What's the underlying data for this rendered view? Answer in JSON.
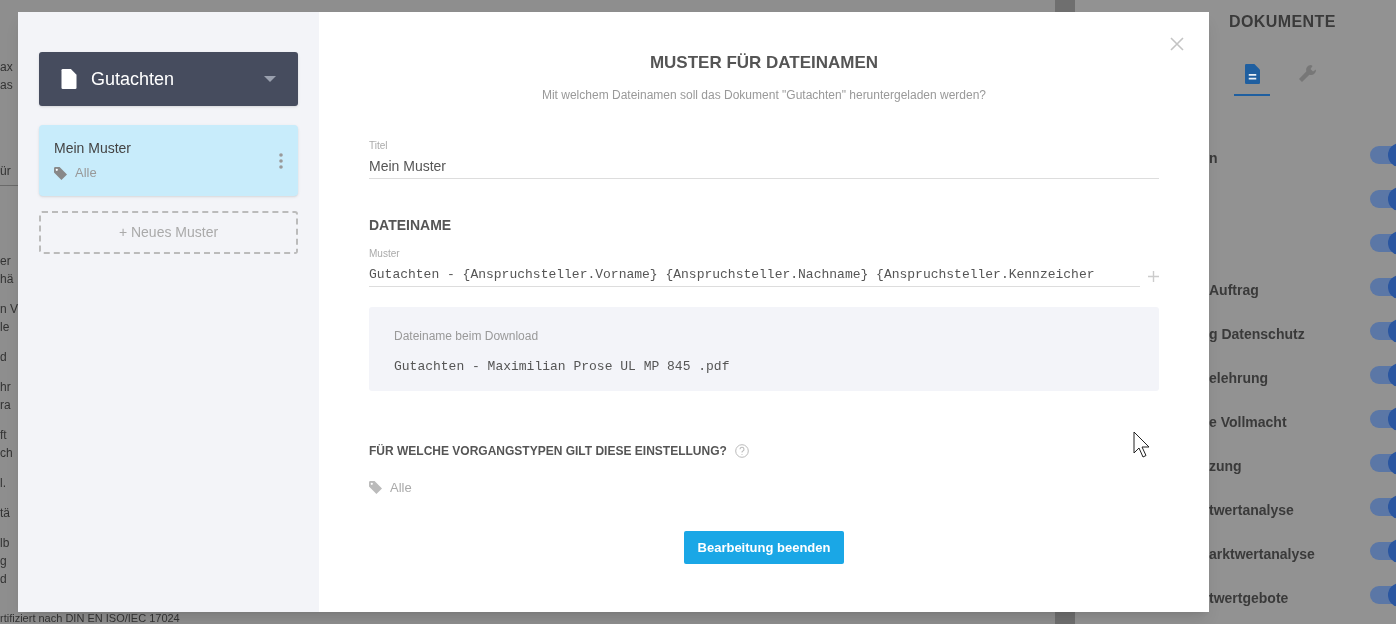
{
  "background": {
    "left_fragments": [
      "ax",
      "as",
      "ür",
      "er",
      "hä",
      "n V",
      "le",
      "d",
      "hr",
      "ra",
      "ft",
      "ch",
      "l.",
      "tä",
      "lb",
      "g",
      "d"
    ],
    "footer_fragment": "rtifiziert nach DIN EN ISO/IEC 17024",
    "panel": {
      "title": "DOKUMENTE",
      "tabs": [
        {
          "kind": "document",
          "selected": true
        },
        {
          "kind": "wrench",
          "selected": false
        }
      ],
      "rows": [
        {
          "label": "n",
          "on": true
        },
        {
          "on": true
        },
        {
          "on": true
        },
        {
          "label": "Auftrag",
          "on": true
        },
        {
          "label": "g Datenschutz",
          "on": true
        },
        {
          "label": "elehrung",
          "on": true
        },
        {
          "label": "e Vollmacht",
          "on": true
        },
        {
          "label": "zung",
          "on": true
        },
        {
          "label": "twertanalyse",
          "on": true
        },
        {
          "label": "arktwertanalyse",
          "on": true
        },
        {
          "label": "twertgebote",
          "on": true
        }
      ]
    }
  },
  "modal": {
    "document_select": {
      "label": "Gutachten"
    },
    "patterns": [
      {
        "title": "Mein Muster",
        "tag": "Alle",
        "selected": true
      }
    ],
    "new_pattern_button": "+ Neues Muster",
    "title": "MUSTER FÜR DATEINAMEN",
    "subtitle": "Mit welchem Dateinamen soll das Dokument \"Gutachten\" heruntergeladen werden?",
    "title_field": {
      "label": "Titel",
      "value": "Mein Muster"
    },
    "filename_heading": "DATEINAME",
    "pattern_field": {
      "label": "Muster",
      "value": "Gutachten - {Anspruchsteller.Vorname} {Anspruchsteller.Nachname} {Anspruchsteller.Kennzeicher"
    },
    "preview": {
      "label": "Dateiname beim Download",
      "value": "Gutachten - Maximilian Prose UL MP 845 .pdf"
    },
    "scope_heading": "FÜR WELCHE VORGANGSTYPEN GILT DIESE EINSTELLUNG?",
    "scope_tag": "Alle",
    "finish_button": "Bearbeitung beenden"
  }
}
